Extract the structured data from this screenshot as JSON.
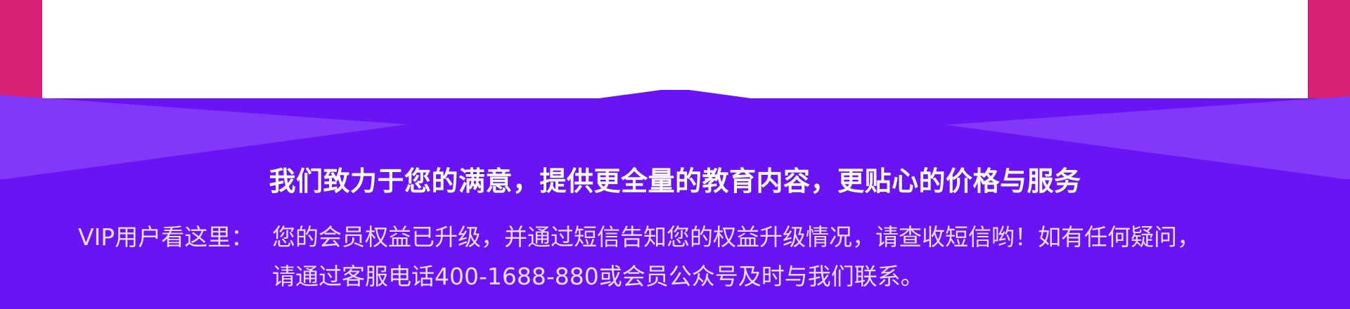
{
  "colors": {
    "side_pink": "#d82077",
    "panel_white": "#ffffff",
    "purple_light": "#8138f8",
    "purple_main": "#6a14f5",
    "text_white": "#ffffff",
    "text_light": "#e9ddff"
  },
  "banner": {
    "headline": "我们致力于您的满意，提供更全量的教育内容，更贴心的价格与服务",
    "notice_label": "VIP用户看这里：",
    "notice_line1": "您的会员权益已升级，并通过短信告知您的权益升级情况，请查收短信哟！如有任何疑问，",
    "notice_line2": "请通过客服电话400-1688-880或会员公众号及时与我们联系。"
  }
}
